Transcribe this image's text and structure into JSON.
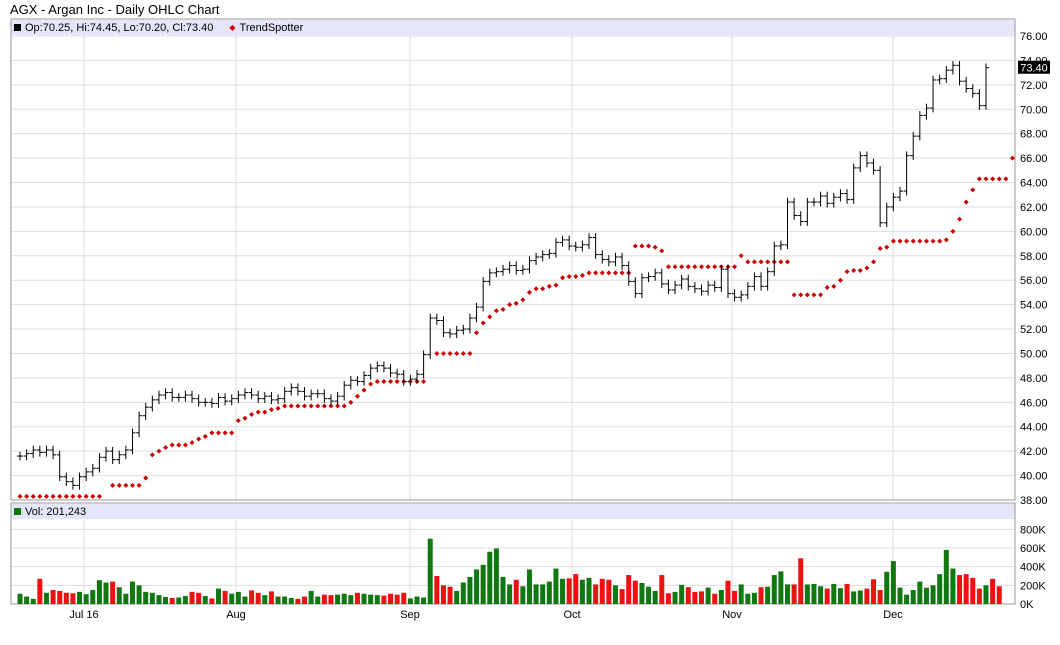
{
  "header": {
    "title": "AGX - Argan Inc - Daily OHLC Chart",
    "ohlc_legend": "Op:70.25, Hi:74.45, Lo:70.20, Cl:73.40",
    "trendspotter_label": "TrendSpotter",
    "volume_legend": "Vol: 201,243",
    "last_price_tag": "73.40"
  },
  "colors": {
    "price_bar": "#000000",
    "trendspotter": "#cc0000",
    "volume_up": "#117711",
    "volume_down": "#ee1111",
    "legend_bg": "#e6e6fa",
    "grid": "#dddddd"
  },
  "chart_data": [
    {
      "type": "ohlc",
      "title": "AGX - Argan Inc - Daily OHLC Chart",
      "y_axis_side": "right",
      "ylim": [
        38,
        76
      ],
      "y_ticks": [
        "76.00",
        "74.00",
        "72.00",
        "70.00",
        "68.00",
        "66.00",
        "64.00",
        "62.00",
        "60.00",
        "58.00",
        "56.00",
        "54.00",
        "52.00",
        "50.00",
        "48.00",
        "46.00",
        "44.00",
        "42.00",
        "40.00",
        "38.00"
      ],
      "x_ticks": [
        "Jul 16",
        "Aug",
        "Sep",
        "Oct",
        "Nov",
        "Dec"
      ],
      "grid": true,
      "series": [
        {
          "name": "AGX",
          "close": [
            41.6,
            41.8,
            42.1,
            41.9,
            42.1,
            41.7,
            39.9,
            39.5,
            39.2,
            39.9,
            40.3,
            40.6,
            41.5,
            42.0,
            41.3,
            41.7,
            42.1,
            43.5,
            44.9,
            45.6,
            46.2,
            46.6,
            46.8,
            46.4,
            46.4,
            46.6,
            46.3,
            46.0,
            46.0,
            45.9,
            46.4,
            46.1,
            46.3,
            46.6,
            46.8,
            46.6,
            46.3,
            46.5,
            46.2,
            46.3,
            46.9,
            47.2,
            46.9,
            46.5,
            46.7,
            46.7,
            46.3,
            46.1,
            46.5,
            47.4,
            47.8,
            47.7,
            48.2,
            48.8,
            49.0,
            48.8,
            48.4,
            48.3,
            47.7,
            47.9,
            48.3,
            49.9,
            52.9,
            52.7,
            51.7,
            51.6,
            51.9,
            52.0,
            52.9,
            53.8,
            55.9,
            56.6,
            56.7,
            56.9,
            57.2,
            56.8,
            56.9,
            57.6,
            57.9,
            58.1,
            58.2,
            59.1,
            59.3,
            58.8,
            58.7,
            58.9,
            59.5,
            58.1,
            57.7,
            57.5,
            57.9,
            57.2,
            55.9,
            54.9,
            56.2,
            56.3,
            56.6,
            55.7,
            55.2,
            55.6,
            56.1,
            55.5,
            55.3,
            55.1,
            55.6,
            55.4,
            56.9,
            54.9,
            54.6,
            54.8,
            55.5,
            56.3,
            55.5,
            56.7,
            58.8,
            58.9,
            62.4,
            61.3,
            60.8,
            62.4,
            62.4,
            62.9,
            62.3,
            62.8,
            63.1,
            62.6,
            65.2,
            66.2,
            65.6,
            65.0,
            60.7,
            62.0,
            62.8,
            63.3,
            66.2,
            67.8,
            69.5,
            70.1,
            72.4,
            72.5,
            73.2,
            73.6,
            72.3,
            71.7,
            71.3,
            70.3,
            73.4
          ]
        },
        {
          "name": "TrendSpotter",
          "values": [
            38.3,
            38.3,
            38.3,
            38.3,
            38.3,
            38.3,
            38.3,
            38.3,
            38.3,
            38.3,
            38.3,
            38.3,
            38.3,
            null,
            39.2,
            39.2,
            39.2,
            39.2,
            39.2,
            39.8,
            41.7,
            42.0,
            42.3,
            42.5,
            42.5,
            42.5,
            42.7,
            43.0,
            43.2,
            43.5,
            43.5,
            43.5,
            43.5,
            44.5,
            44.7,
            45.0,
            45.2,
            45.2,
            45.4,
            45.5,
            45.7,
            45.7,
            45.7,
            45.7,
            45.7,
            45.7,
            45.7,
            45.7,
            45.7,
            45.7,
            46.0,
            46.5,
            47.0,
            47.5,
            47.7,
            47.7,
            47.7,
            47.7,
            47.7,
            47.7,
            47.7,
            47.7,
            null,
            50.0,
            50.0,
            50.0,
            50.0,
            50.0,
            50.0,
            51.7,
            52.5,
            53.0,
            53.5,
            53.6,
            54.0,
            54.1,
            54.4,
            55.0,
            55.3,
            55.3,
            55.5,
            55.6,
            56.2,
            56.3,
            56.3,
            56.4,
            56.6,
            56.6,
            56.6,
            56.6,
            56.6,
            56.6,
            56.6,
            58.8,
            58.8,
            58.8,
            58.7,
            58.4,
            57.1,
            57.1,
            57.1,
            57.1,
            57.1,
            57.1,
            57.1,
            57.1,
            57.1,
            57.1,
            57.1,
            58.0,
            57.5,
            57.5,
            57.5,
            57.5,
            57.5,
            57.5,
            57.5,
            54.8,
            54.8,
            54.8,
            54.8,
            54.8,
            55.4,
            55.5,
            56.0,
            56.7,
            56.8,
            56.8,
            57.0,
            57.5,
            58.6,
            58.7,
            59.2,
            59.2,
            59.2,
            59.2,
            59.2,
            59.2,
            59.2,
            59.2,
            59.3,
            60.0,
            61.0,
            62.4,
            63.4,
            64.3,
            64.3,
            64.3,
            64.3,
            64.3,
            66.0
          ]
        }
      ]
    },
    {
      "type": "bar",
      "title": "Volume",
      "y_axis_side": "right",
      "ylim": [
        0,
        900000
      ],
      "y_ticks": [
        "800K",
        "600K",
        "400K",
        "200K",
        "0K"
      ],
      "series": [
        {
          "name": "Vol",
          "values": [
            110000,
            80000,
            55000,
            270000,
            120000,
            150000,
            140000,
            120000,
            115000,
            130000,
            105000,
            150000,
            255000,
            230000,
            240000,
            180000,
            110000,
            240000,
            200000,
            130000,
            120000,
            95000,
            75000,
            65000,
            70000,
            85000,
            130000,
            120000,
            85000,
            60000,
            165000,
            140000,
            110000,
            130000,
            80000,
            145000,
            120000,
            95000,
            135000,
            80000,
            80000,
            65000,
            55000,
            80000,
            140000,
            80000,
            100000,
            95000,
            100000,
            110000,
            95000,
            120000,
            110000,
            100000,
            95000,
            90000,
            110000,
            100000,
            120000,
            60000,
            80000,
            70000,
            700000,
            300000,
            200000,
            185000,
            140000,
            230000,
            290000,
            370000,
            420000,
            560000,
            595000,
            290000,
            210000,
            260000,
            190000,
            370000,
            210000,
            210000,
            240000,
            380000,
            270000,
            275000,
            320000,
            260000,
            280000,
            210000,
            270000,
            260000,
            200000,
            160000,
            310000,
            250000,
            225000,
            185000,
            140000,
            310000,
            115000,
            130000,
            205000,
            180000,
            130000,
            135000,
            175000,
            110000,
            150000,
            250000,
            140000,
            210000,
            110000,
            120000,
            180000,
            185000,
            310000,
            350000,
            210000,
            210000,
            490000,
            210000,
            215000,
            190000,
            165000,
            215000,
            170000,
            215000,
            135000,
            145000,
            165000,
            265000,
            150000,
            345000,
            460000,
            175000,
            100000,
            150000,
            240000,
            175000,
            200000,
            320000,
            580000,
            380000,
            310000,
            320000,
            280000,
            165000,
            200000,
            270000,
            190000
          ]
        }
      ]
    }
  ]
}
